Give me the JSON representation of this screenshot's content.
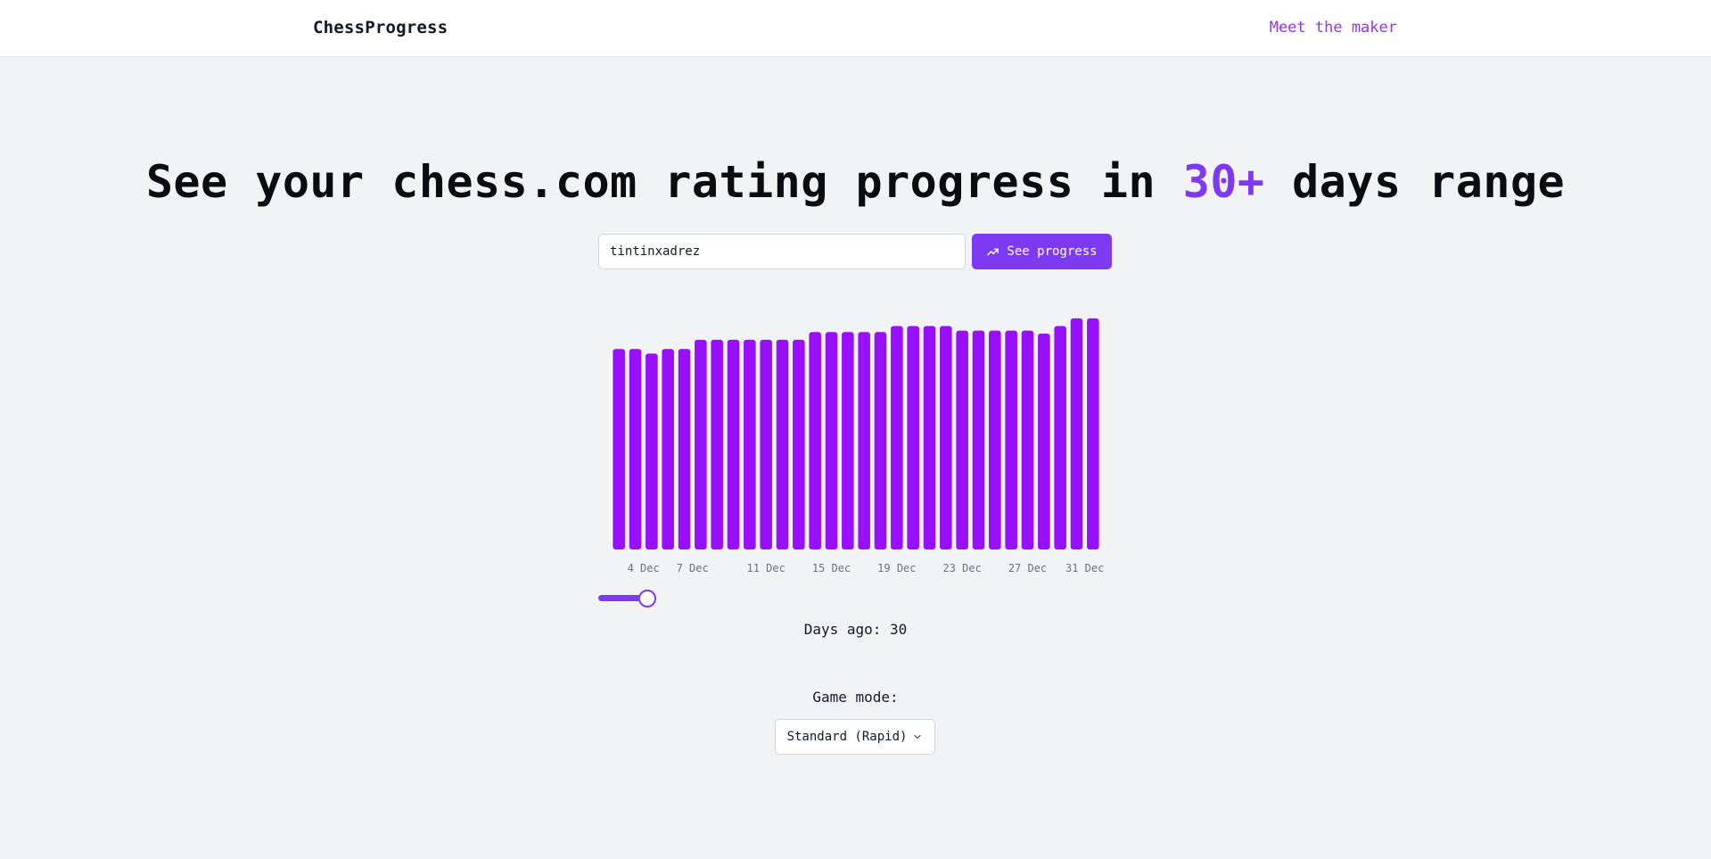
{
  "header": {
    "brand": "ChessProgress",
    "maker_link": "Meet the maker"
  },
  "hero": {
    "title_before": "See your chess.com rating progress in ",
    "title_accent": "30+",
    "title_after": " days range"
  },
  "search": {
    "value": "tintinxadrez",
    "button_label": "See progress",
    "button_icon": "trending-up-icon"
  },
  "chart_data": {
    "type": "bar",
    "values": [
      1262,
      1262,
      1256,
      1262,
      1262,
      1274,
      1274,
      1274,
      1274,
      1274,
      1274,
      1274,
      1284,
      1284,
      1284,
      1284,
      1284,
      1292,
      1292,
      1292,
      1292,
      1286,
      1286,
      1286,
      1286,
      1286,
      1282,
      1292,
      1302,
      1302
    ],
    "x_tick_labels": [
      "4 Dec",
      "7 Dec",
      "11 Dec",
      "15 Dec",
      "19 Dec",
      "23 Dec",
      "27 Dec",
      "31 Dec"
    ],
    "x_tick_bar_index": [
      1.5,
      4.5,
      9,
      13,
      17,
      21,
      25,
      28.5
    ],
    "ylim": [
      1000,
      1310
    ],
    "bar_color": "#9810fa",
    "tick_color": "#6b7280",
    "grid": false,
    "legend": "none"
  },
  "range": {
    "slider_value": 30,
    "days_label": "Days ago: ",
    "days_value": "30"
  },
  "mode": {
    "label": "Game mode:",
    "selected": "Standard (Rapid)"
  },
  "colors": {
    "accent": "#7e3af2",
    "link": "#9333ea",
    "background": "#f2f3f5"
  }
}
